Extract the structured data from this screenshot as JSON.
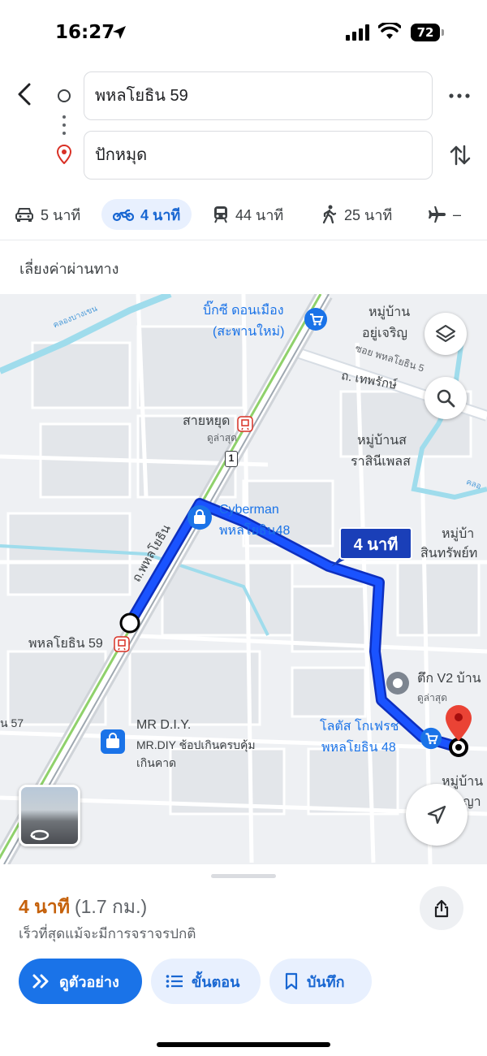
{
  "status_bar": {
    "time": "16:27",
    "battery": "72"
  },
  "search": {
    "origin": "พหลโยธิน 59",
    "destination": "ปักหมุด"
  },
  "modes": [
    {
      "icon": "car-icon",
      "label": "5 นาที"
    },
    {
      "icon": "motorcycle-icon",
      "label": "4 นาที",
      "active": true
    },
    {
      "icon": "transit-icon",
      "label": "44 นาที"
    },
    {
      "icon": "walk-icon",
      "label": "25 นาที"
    },
    {
      "icon": "flight-icon",
      "label": "–"
    }
  ],
  "options": {
    "avoid_tolls": "เลี่ยงค่าผ่านทาง"
  },
  "map": {
    "eta_bubble": "4 นาที",
    "labels": {
      "bigc_1": "บิ๊กซี ดอนเมือง",
      "bigc_2": "(สะพานใหม่)",
      "village1_1": "หมู่บ้าน",
      "village1_2": "อยู่เจริญ",
      "soi_phahon": "ซอย พหลโยธิน 5",
      "thepharak": "ถ. เทพรักษ์",
      "canal_top": "คลองบางเขน",
      "canal_right": "คลอ",
      "saiyud": "สายหยุด",
      "saiyud_sub": "ดูล่าสุด",
      "village2_1": "หมู่บ้านส",
      "village2_2": "ราสินีเพลส",
      "cyberman_1": "Cyberman",
      "cyberman_2": "พหลโยธิน48",
      "village3_1": "หมู่บ้า",
      "village3_2": "สินทรัพย์ท",
      "road_phahon": "ถ.พหลโยธิน",
      "phahon59": "พหลโยธิน 59",
      "tower_v2": "ตึก V2 บ้าน",
      "tower_sub": "ดูล่าสุด",
      "lotus_1": "โลตัส โกเฟรช",
      "lotus_2": "พหลโยธิน 48",
      "mrdiy_1": "MR D.I.Y.",
      "mrdiy_2": "MR.DIY ช้อปเกินครบคุ้ม",
      "mrdiy_3": "เกินคาด",
      "village4_1": "หมู่บ้าน",
      "village4_2": "ญา",
      "soi57": "น 57",
      "route_shield": "1"
    }
  },
  "sheet": {
    "eta": "4 นาที",
    "distance": "(1.7 กม.)",
    "note": "เร็วที่สุดแม้จะมีการจราจรปกติ",
    "preview_label": "ดูตัวอย่าง",
    "steps_label": "ขั้นตอน",
    "save_label": "บันทึก"
  },
  "colors": {
    "accent": "#1a73e8",
    "route": "#1a53ff",
    "eta_orange": "#c5610b"
  }
}
